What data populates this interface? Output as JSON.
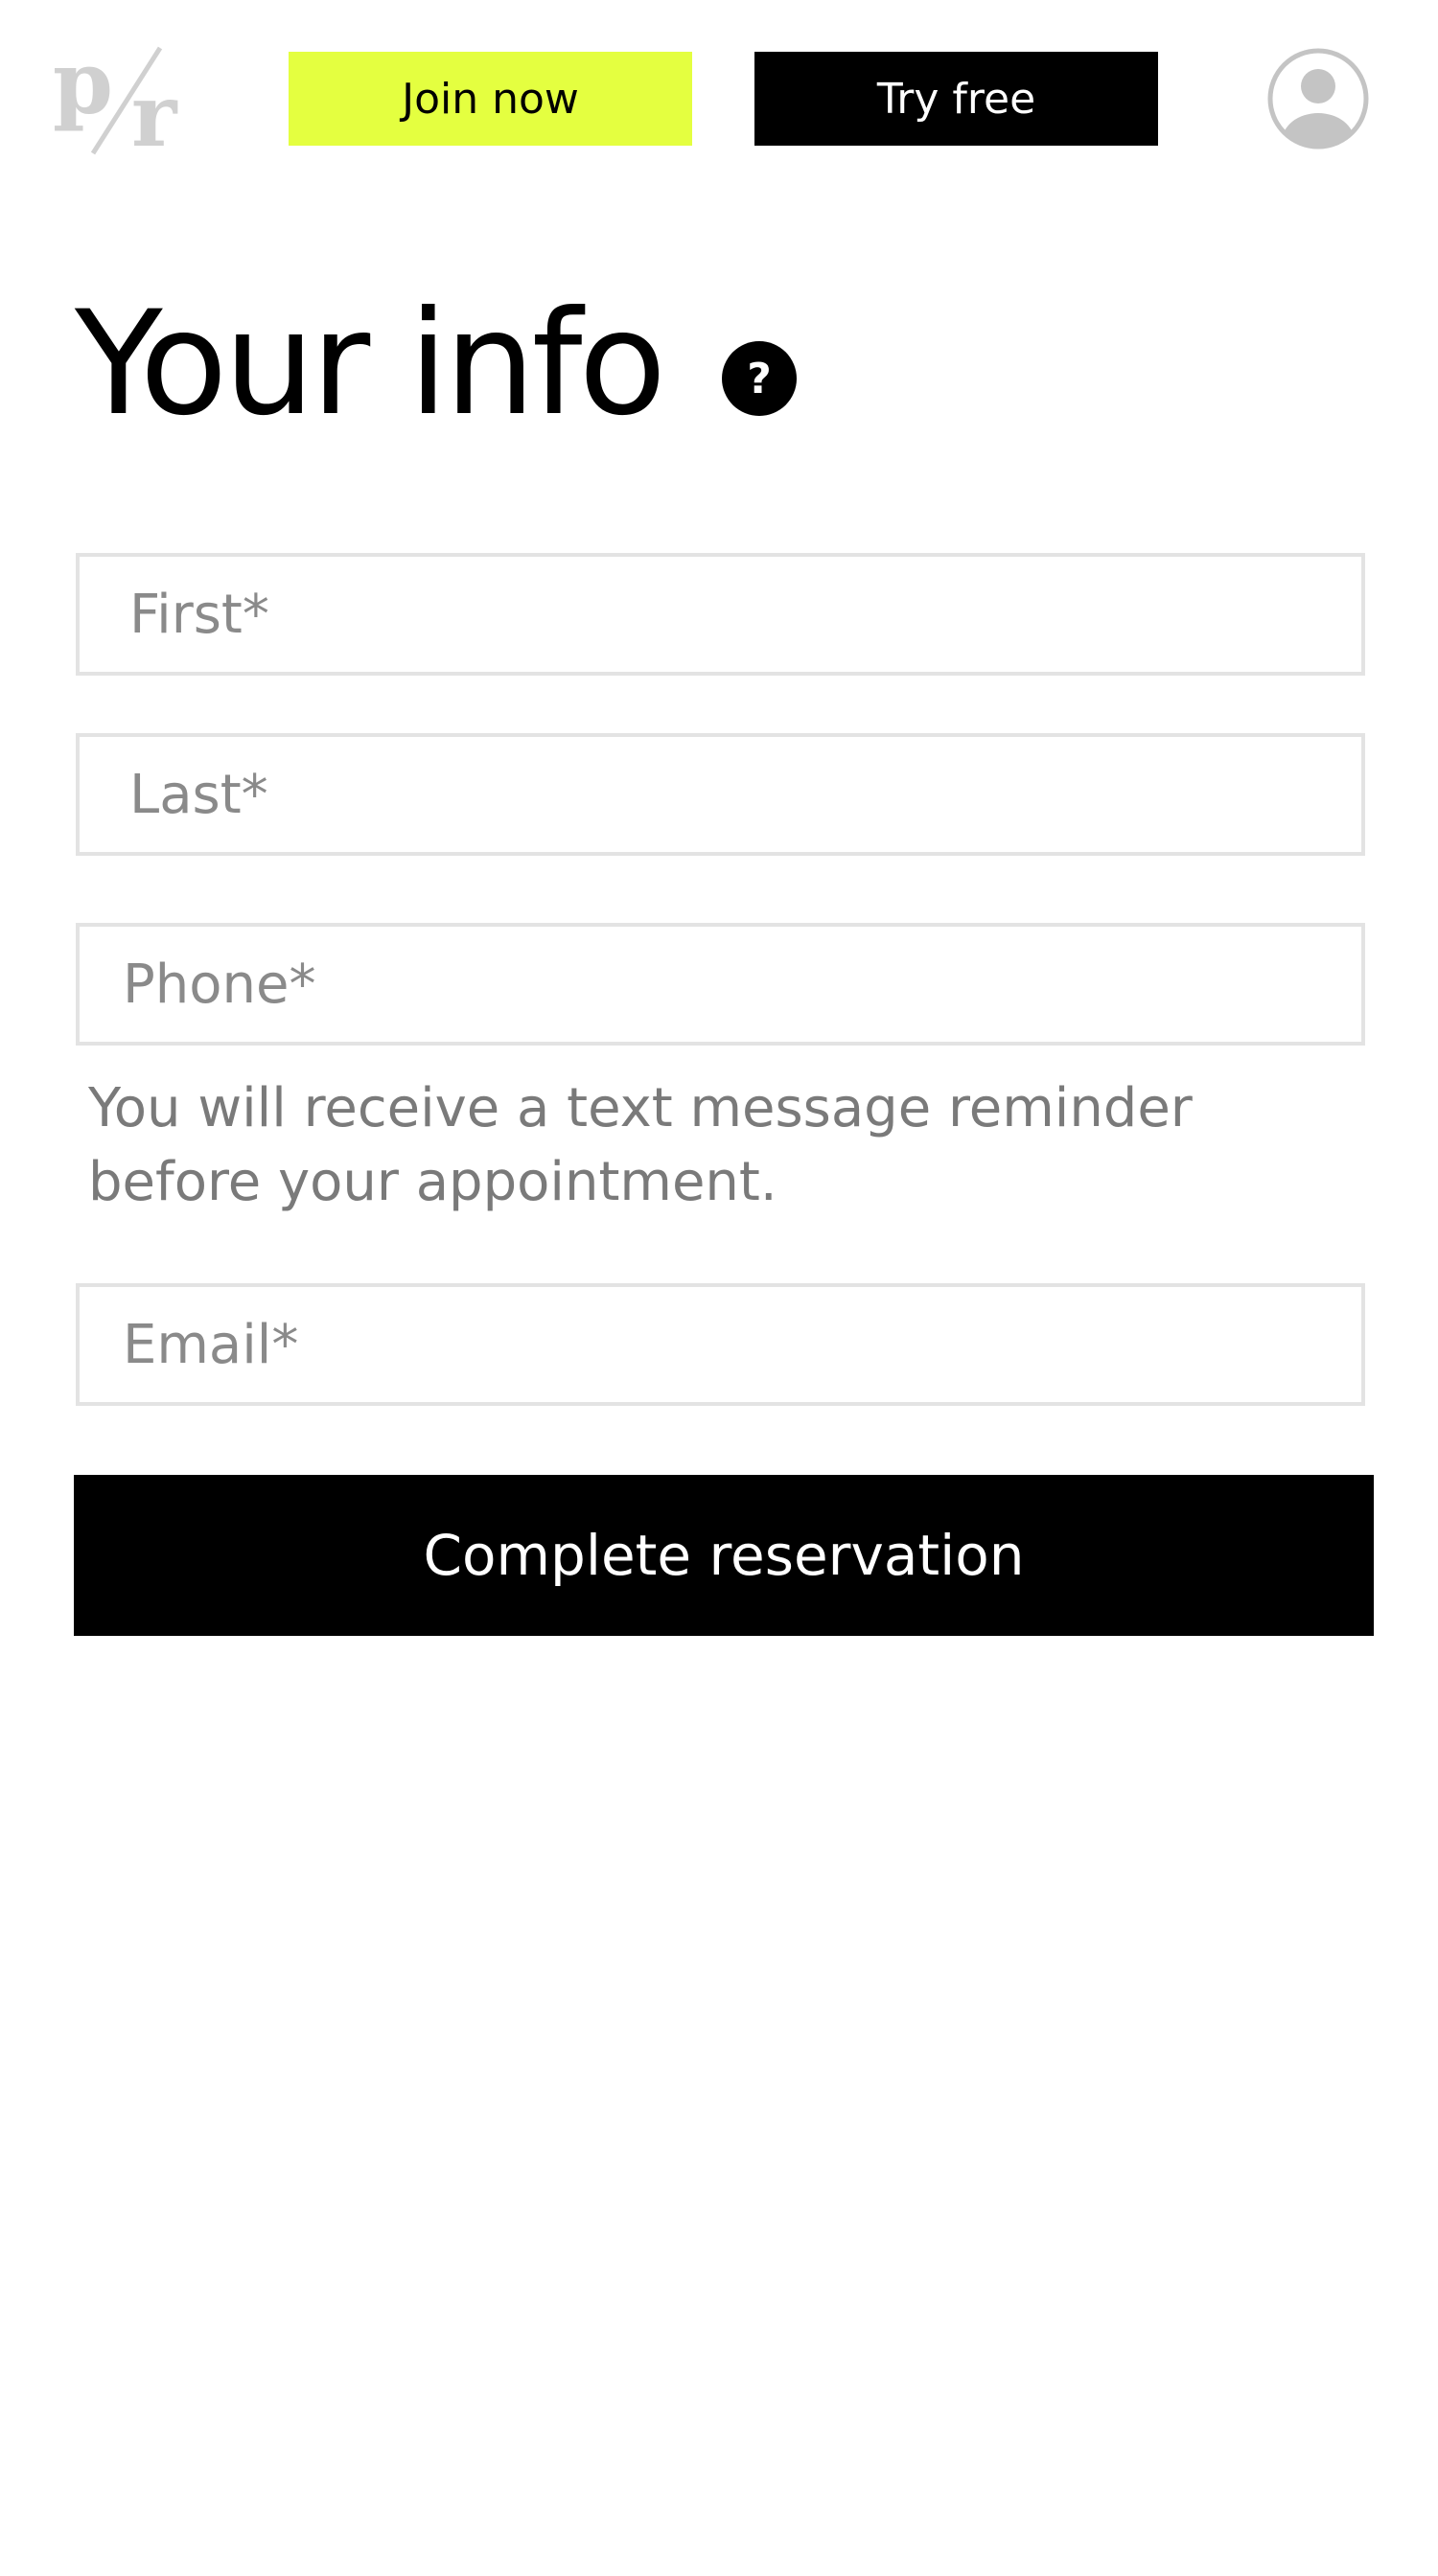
{
  "header": {
    "logo_text": "p/r",
    "join_label": "Join now",
    "try_label": "Try free",
    "profile_icon": "user-circle-icon"
  },
  "main": {
    "title": "Your info",
    "help_icon": "question-circle-icon",
    "fields": {
      "first_placeholder": "First*",
      "last_placeholder": "Last*",
      "phone_placeholder": "Phone*",
      "email_placeholder": "Email*"
    },
    "phone_helper": "You will receive a text message reminder before your appointment.",
    "submit_label": "Complete reservation"
  },
  "colors": {
    "accent": "#e4ff40",
    "primary": "#000000",
    "primary_text": "#ffffff",
    "border": "#e3e3e3",
    "muted_text": "#7a7a7a",
    "logo": "#d0d0d0",
    "icon_gray": "#c4c4c4"
  }
}
